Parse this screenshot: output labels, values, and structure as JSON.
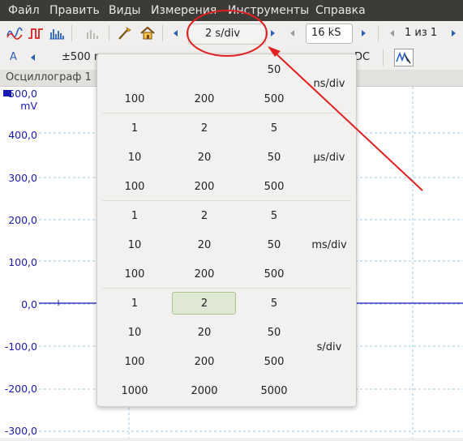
{
  "menu": [
    "Файл",
    "Править",
    "Виды",
    "Измерения",
    "Инструменты",
    "Справка"
  ],
  "toolbar": {
    "timebase": "2 s/div",
    "samples": "16 kS",
    "page": "1 из 1"
  },
  "toolbar2": {
    "channel": "A",
    "range": "±500 m",
    "coupling": "DC"
  },
  "tab": "Осциллограф 1",
  "y_axis": {
    "unit": "mV",
    "ticks": [
      "500,0",
      "400,0",
      "300,0",
      "200,0",
      "100,0",
      "0,0",
      "-100,0",
      "-200,0",
      "-300,0"
    ]
  },
  "popup": {
    "units": [
      "ns/div",
      "μs/div",
      "ms/div",
      "s/div"
    ],
    "ns_rows": [
      [
        "",
        "",
        "50"
      ],
      [
        "100",
        "200",
        "500"
      ]
    ],
    "us_rows": [
      [
        "1",
        "2",
        "5"
      ],
      [
        "10",
        "20",
        "50"
      ],
      [
        "100",
        "200",
        "500"
      ]
    ],
    "ms_rows": [
      [
        "1",
        "2",
        "5"
      ],
      [
        "10",
        "20",
        "50"
      ],
      [
        "100",
        "200",
        "500"
      ]
    ],
    "s_rows": [
      [
        "1",
        "2",
        "5"
      ],
      [
        "10",
        "20",
        "50"
      ],
      [
        "100",
        "200",
        "500"
      ],
      [
        "1000",
        "2000",
        "5000"
      ]
    ],
    "selected": "2 s/div"
  },
  "colors": {
    "accent": "#2a62b8",
    "annotation": "#e02020",
    "trace": "#1a1ab4",
    "selected_bg": "#dfe8d4"
  }
}
